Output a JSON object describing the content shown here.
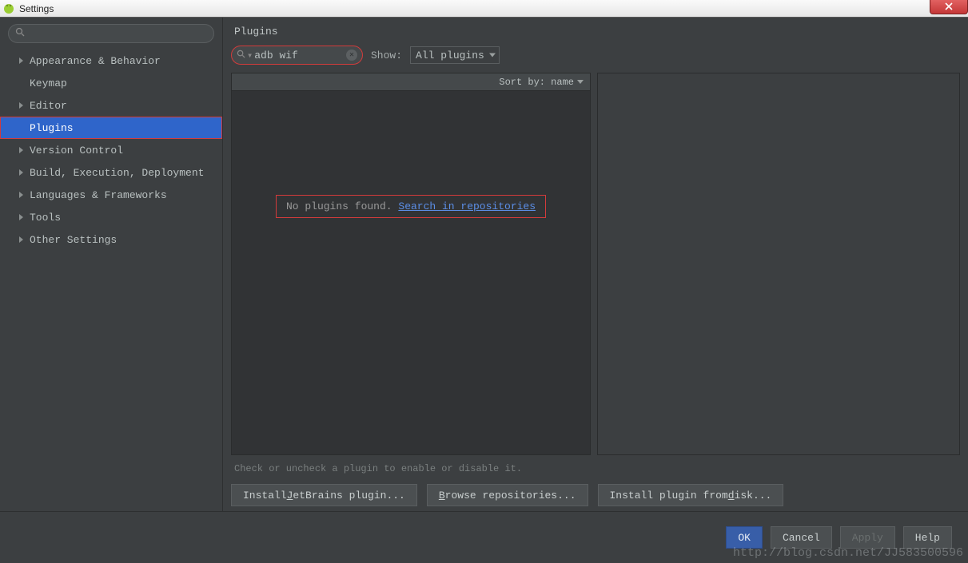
{
  "window": {
    "title": "Settings"
  },
  "sidebar": {
    "search_placeholder": "",
    "items": [
      {
        "label": "Appearance & Behavior",
        "expandable": true
      },
      {
        "label": "Keymap",
        "expandable": false
      },
      {
        "label": "Editor",
        "expandable": true
      },
      {
        "label": "Plugins",
        "expandable": false,
        "selected": true
      },
      {
        "label": "Version Control",
        "expandable": true
      },
      {
        "label": "Build, Execution, Deployment",
        "expandable": true
      },
      {
        "label": "Languages & Frameworks",
        "expandable": true
      },
      {
        "label": "Tools",
        "expandable": true
      },
      {
        "label": "Other Settings",
        "expandable": true
      }
    ]
  },
  "main": {
    "title": "Plugins",
    "search_value": "adb wif",
    "show_label": "Show:",
    "show_value": "All plugins",
    "sort_label": "Sort by: name",
    "empty_text": "No plugins found. ",
    "empty_link": "Search in repositories",
    "help_text": "Check or uncheck a plugin to enable or disable it.",
    "buttons": {
      "install_jb_pre": "Install ",
      "install_jb_ul": "J",
      "install_jb_post": "etBrains plugin...",
      "browse_ul": "B",
      "browse_post": "rowse repositories...",
      "install_disk_pre": "Install plugin from ",
      "install_disk_ul": "d",
      "install_disk_post": "isk..."
    }
  },
  "footer": {
    "ok": "OK",
    "cancel": "Cancel",
    "apply": "Apply",
    "help": "Help"
  },
  "watermark": "http://blog.csdn.net/JJ583500596"
}
